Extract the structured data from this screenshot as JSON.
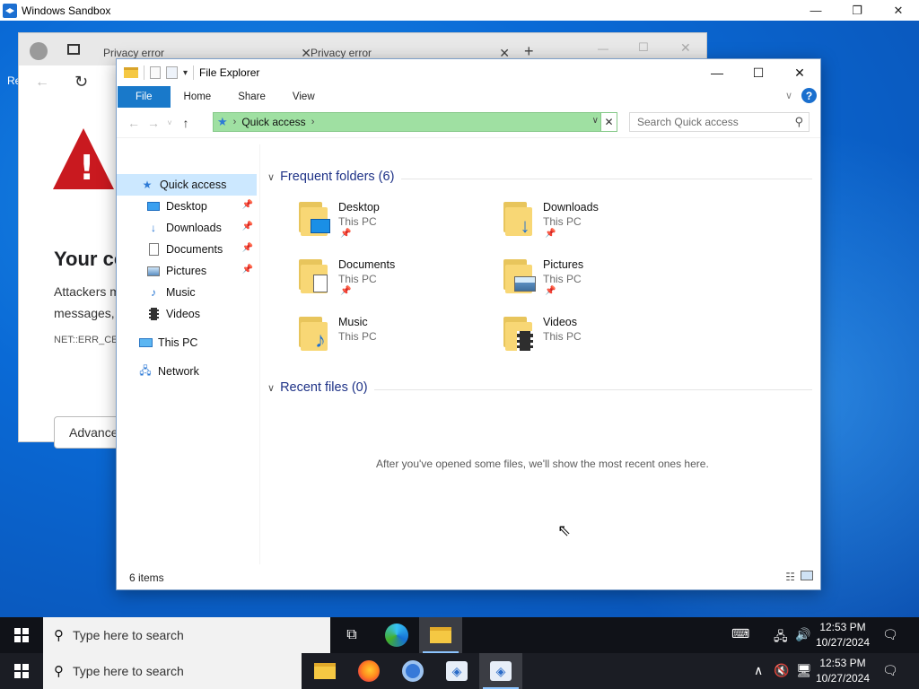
{
  "sandbox": {
    "title": "Windows Sandbox"
  },
  "desktop": {
    "label": "Re"
  },
  "browser": {
    "tabs": [
      "Privacy error",
      "Privacy error"
    ],
    "error_title": "Your co",
    "error_text_1": "Attackers m",
    "error_text_2": "messages, c",
    "error_code": "NET::ERR_CEF",
    "advanced_label": "Advance"
  },
  "explorer": {
    "title": "File Explorer",
    "ribbon_tabs": [
      "File",
      "Home",
      "Share",
      "View"
    ],
    "address": {
      "location": "Quick access"
    },
    "search": {
      "placeholder": "Search Quick access"
    },
    "nav": [
      {
        "label": "Quick access",
        "pinned": false
      },
      {
        "label": "Desktop",
        "pinned": true
      },
      {
        "label": "Downloads",
        "pinned": true
      },
      {
        "label": "Documents",
        "pinned": true
      },
      {
        "label": "Pictures",
        "pinned": true
      },
      {
        "label": "Music",
        "pinned": false
      },
      {
        "label": "Videos",
        "pinned": false
      },
      {
        "label": "This PC",
        "pinned": false
      },
      {
        "label": "Network",
        "pinned": false
      }
    ],
    "frequent_header": "Frequent folders (6)",
    "folders": [
      {
        "name": "Desktop",
        "location": "This PC",
        "icon": "desktop-icon"
      },
      {
        "name": "Downloads",
        "location": "This PC",
        "icon": "download-arrow-icon"
      },
      {
        "name": "Documents",
        "location": "This PC",
        "icon": "document-icon"
      },
      {
        "name": "Pictures",
        "location": "This PC",
        "icon": "picture-icon"
      },
      {
        "name": "Music",
        "location": "This PC",
        "icon": "music-note-icon"
      },
      {
        "name": "Videos",
        "location": "This PC",
        "icon": "film-strip-icon"
      }
    ],
    "recent_header": "Recent files (0)",
    "recent_empty": "After you've opened some files, we'll show the most recent ones here.",
    "status": "6 items"
  },
  "taskbar_inner": {
    "search_placeholder": "Type here to search",
    "time": "12:53 PM",
    "date": "10/27/2024"
  },
  "taskbar_host": {
    "search_placeholder": "Type here to search",
    "time": "12:53 PM",
    "date": "10/27/2024"
  },
  "colors": {
    "accent": "#1979ca",
    "address_highlight": "#9fe0a2",
    "folder_yellow": "#f8d775",
    "desktop_blue": "#0a63c4"
  }
}
